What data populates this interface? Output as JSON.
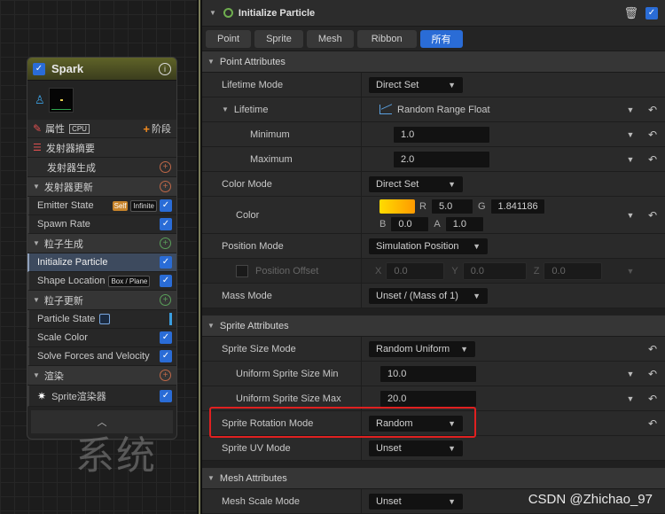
{
  "node": {
    "title": "Spark",
    "properties_label": "属性",
    "cpu_badge": "CPU",
    "stage_button": "阶段",
    "emitter_summary": "发射器摘要",
    "sections": [
      {
        "label": "发射器生成",
        "type": "stage"
      },
      {
        "label": "发射器更新",
        "type": "section"
      },
      {
        "label": "粒子生成",
        "type": "section"
      },
      {
        "label": "粒子更新",
        "type": "section"
      },
      {
        "label": "渲染",
        "type": "section"
      }
    ],
    "modules": {
      "emitter_state": "Emitter State",
      "emitter_state_badge1": "Self",
      "emitter_state_badge2": "Infinite",
      "spawn_rate": "Spawn Rate",
      "initialize_particle": "Initialize Particle",
      "shape_location": "Shape Location",
      "shape_location_badge": "Box / Plane",
      "particle_state": "Particle State",
      "scale_color": "Scale Color",
      "solve_forces": "Solve Forces and Velocity",
      "sprite_renderer": "Sprite渲染器"
    }
  },
  "watermark_left": "系统",
  "watermark_right": "CSDN @Zhichao_97",
  "panel": {
    "title": "Initialize Particle",
    "tabs": [
      "Point",
      "Sprite",
      "Mesh",
      "Ribbon",
      "所有"
    ],
    "active_tab": "所有",
    "categories": {
      "point": "Point Attributes",
      "sprite": "Sprite Attributes",
      "mesh": "Mesh Attributes"
    },
    "rows": {
      "lifetime_mode": {
        "name": "Lifetime Mode",
        "value": "Direct Set"
      },
      "lifetime": {
        "name": "Lifetime",
        "value": "Random Range Float"
      },
      "minimum": {
        "name": "Minimum",
        "value": "1.0"
      },
      "maximum": {
        "name": "Maximum",
        "value": "2.0"
      },
      "color_mode": {
        "name": "Color Mode",
        "value": "Direct Set"
      },
      "color": {
        "name": "Color",
        "r": "5.0",
        "g": "1.841186",
        "b": "0.0",
        "a": "1.0",
        "r_label": "R",
        "g_label": "G",
        "b_label": "B",
        "a_label": "A"
      },
      "position_mode": {
        "name": "Position Mode",
        "value": "Simulation Position"
      },
      "position_offset": {
        "name": "Position Offset",
        "x": "0.0",
        "y": "0.0",
        "z": "0.0",
        "x_label": "X",
        "y_label": "Y",
        "z_label": "Z"
      },
      "mass_mode": {
        "name": "Mass Mode",
        "value": "Unset / (Mass of 1)"
      },
      "sprite_size_mode": {
        "name": "Sprite Size Mode",
        "value": "Random Uniform"
      },
      "uniform_min": {
        "name": "Uniform Sprite Size Min",
        "value": "10.0"
      },
      "uniform_max": {
        "name": "Uniform Sprite Size Max",
        "value": "20.0"
      },
      "sprite_rotation_mode": {
        "name": "Sprite Rotation Mode",
        "value": "Random"
      },
      "sprite_uv_mode": {
        "name": "Sprite UV Mode",
        "value": "Unset"
      },
      "mesh_scale_mode": {
        "name": "Mesh Scale Mode",
        "value": "Unset"
      }
    },
    "colors": {
      "accent": "#2a6cd6",
      "highlight": "#e02020",
      "color_swatch": "#ffc800"
    }
  }
}
